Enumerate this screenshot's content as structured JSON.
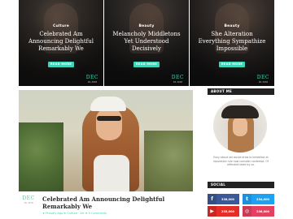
{
  "slider": {
    "slides": [
      {
        "category": "Culture",
        "title": "Celebrated Am Announcing Delightful Remarkably We",
        "button": "READ MORE",
        "date_month": "DEC",
        "date_year": "18, 2018"
      },
      {
        "category": "Beauty",
        "title": "Melancholy Middletons Yet Understood Decisively",
        "button": "READ MORE",
        "date_month": "DEC",
        "date_year": "18, 2018"
      },
      {
        "category": "Beauty",
        "title": "She Alteration Everything Sympathize Impossible",
        "button": "READ MORE",
        "date_month": "DEC",
        "date_year": "18, 2018"
      }
    ]
  },
  "post": {
    "date_month": "DEC",
    "date_year": "18, 2018",
    "title": "Celebrated Am Announcing Delightful Remarkably We",
    "meta": "★ Proudly Ago  ⊕  Culture  ·  Art  ⊕  0 Comments"
  },
  "sidebar": {
    "about": {
      "heading": "ABOUT ME",
      "text": "Easy about set would draw to breakfast at reputation rule now consider contempt. Of offended taste by so."
    },
    "social": {
      "heading": "SOCIAL",
      "items": [
        {
          "network": "facebook",
          "icon": "f",
          "count": "336,000"
        },
        {
          "network": "twitter",
          "icon": "t",
          "count": "234,000"
        },
        {
          "network": "youtube",
          "icon": "▶",
          "count": "235,000"
        },
        {
          "network": "instagram",
          "icon": "◎",
          "count": "236,000"
        }
      ]
    }
  },
  "colors": {
    "accent": "#3ed6b8",
    "dark": "#222222",
    "facebook": "#3b5998",
    "twitter": "#1da1f2",
    "youtube": "#e52d27",
    "instagram": "#e4405f"
  }
}
